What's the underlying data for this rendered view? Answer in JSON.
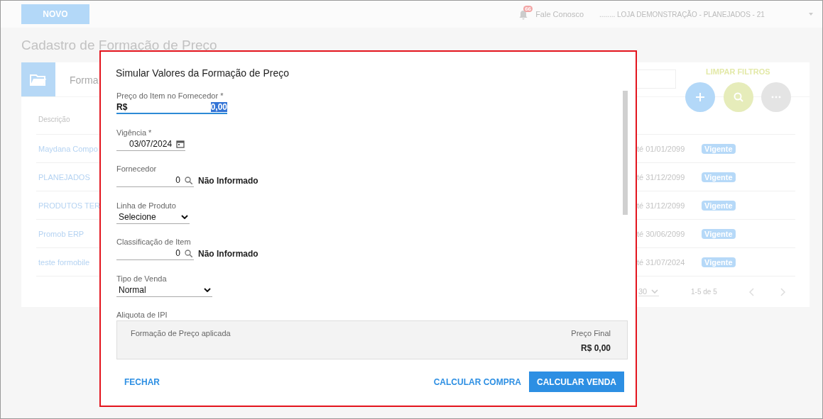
{
  "header": {
    "new_button": "NOVO",
    "notification_count": "66",
    "contact_link": "Fale Conosco",
    "store_selector": "........ LOJA DEMONSTRAÇÃO - PLANEJADOS - 21"
  },
  "page_title": "Cadastro de Formação de Preço",
  "card": {
    "tab_label": "Forma",
    "clear_filters": "LIMPAR FILTROS",
    "table": {
      "columns": [
        "Descrição"
      ],
      "rows": [
        {
          "description": "Maydana Compo",
          "validity": "té 01/01/2099",
          "status": "Vigente"
        },
        {
          "description": "PLANEJADOS",
          "validity": "té 31/12/2099",
          "status": "Vigente"
        },
        {
          "description": "PRODUTOS TER",
          "validity": "té 31/12/2099",
          "status": "Vigente"
        },
        {
          "description": "Promob ERP",
          "validity": "té 30/06/2099",
          "status": "Vigente"
        },
        {
          "description": "teste formobile",
          "validity": "té 31/07/2024",
          "status": "Vigente"
        }
      ]
    },
    "pagination": {
      "page_size": "30",
      "range": "1-5 de 5"
    }
  },
  "dialog": {
    "title": "Simular Valores da Formação de Preço",
    "fields": [
      {
        "kind": "money",
        "label": "Preço do Item no Fornecedor *",
        "prefix": "R$",
        "value": "0,00",
        "focused": true
      },
      {
        "kind": "date",
        "label": "Vigência *",
        "value": "03/07/2024",
        "focused": false
      },
      {
        "kind": "lookup",
        "label": "Fornecedor",
        "value": "0",
        "description": "Não Informado",
        "focused": false
      },
      {
        "kind": "select",
        "label": "Linha de Produto",
        "value": "Selecione",
        "focused": false
      },
      {
        "kind": "lookup",
        "label": "Classificação de Item",
        "value": "0",
        "description": "Não Informado",
        "focused": false
      },
      {
        "kind": "select",
        "label": "Tipo de Venda",
        "value": "Normal",
        "focused": false
      },
      {
        "kind": "label",
        "label": "Aliquota de IPI"
      }
    ],
    "summary": {
      "label": "Formação de Preço aplicada",
      "final_label": "Preço Final",
      "final_value": "R$ 0,00"
    },
    "buttons": [
      {
        "label": "FECHAR",
        "kind": "text"
      },
      {
        "label": "CALCULAR COMPRA",
        "kind": "text"
      },
      {
        "label": "CALCULAR VENDA",
        "kind": "primary"
      }
    ]
  }
}
